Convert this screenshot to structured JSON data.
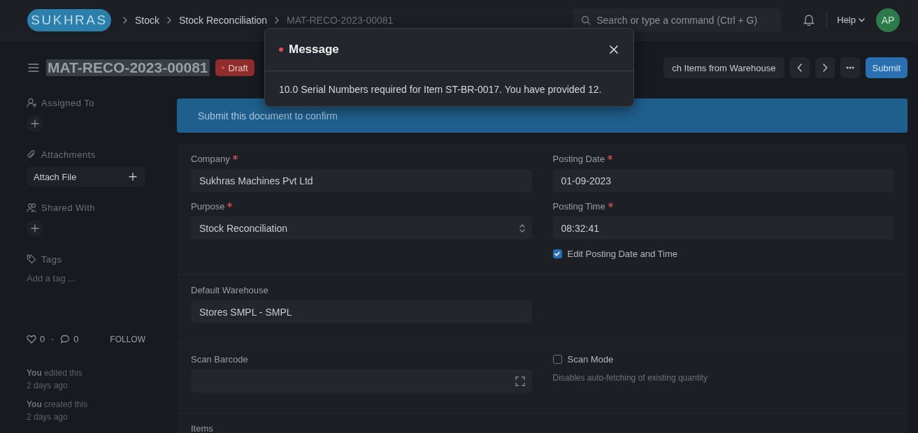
{
  "navbar": {
    "logo": "SUKHRAS",
    "breadcrumbs": [
      "Stock",
      "Stock Reconciliation",
      "MAT-RECO-2023-00081"
    ],
    "search": {
      "placeholder": "Search or type a command (Ctrl + G)"
    },
    "help": "Help",
    "avatar": "AP"
  },
  "page": {
    "title": "MAT-RECO-2023-00081",
    "status": {
      "label": "Draft",
      "color": "#e24c4c"
    },
    "actions": [
      {
        "kind": "button",
        "label": "ch Items from Warehouse"
      },
      {
        "kind": "prev"
      },
      {
        "kind": "next"
      },
      {
        "kind": "more"
      },
      {
        "kind": "primary",
        "label": "Submit"
      }
    ]
  },
  "sidebar": {
    "assigned_to": {
      "label": "Assigned To"
    },
    "attachments": {
      "label": "Attachments",
      "attach": "Attach File"
    },
    "shared_with": {
      "label": "Shared With"
    },
    "tags": {
      "label": "Tags",
      "placeholder": "Add a tag ..."
    },
    "likes": "0",
    "comments": "0",
    "follow": "FOLLOW",
    "activity": [
      {
        "text": "**You** edited this",
        "time": "2 days ago"
      },
      {
        "text": "**You** created this",
        "time": "2 days ago"
      }
    ]
  },
  "banner": "Submit this document to confirm",
  "sections": [
    {
      "columns": [
        [
          {
            "kind": "link",
            "label": "Company",
            "required": true,
            "value": "Sukhras Machines Pvt Ltd"
          },
          {
            "kind": "select",
            "label": "Purpose",
            "required": true,
            "value": "Stock Reconciliation"
          }
        ],
        [
          {
            "kind": "link",
            "label": "Posting Date",
            "required": true,
            "value": "01-09-2023"
          },
          {
            "kind": "link",
            "label": "Posting Time",
            "required": true,
            "value": "08:32:41"
          },
          {
            "kind": "checkbox",
            "label": "Edit Posting Date and Time",
            "checked": true
          }
        ]
      ]
    },
    {
      "columns": [
        [
          {
            "kind": "link",
            "label": "Default Warehouse",
            "required": false,
            "value": "Stores SMPL - SMPL"
          }
        ],
        []
      ]
    },
    {
      "columns": [
        [
          {
            "kind": "barcode",
            "label": "Scan Barcode",
            "required": false
          }
        ],
        [
          {
            "kind": "checkbox",
            "label": "Scan Mode",
            "checked": false,
            "description": "Disables auto-fetching of existing quantity"
          }
        ]
      ]
    },
    {
      "columns": [
        [
          {
            "kind": "heading",
            "label": "Items"
          }
        ],
        []
      ]
    }
  ],
  "modal": {
    "title": "Message",
    "indicator": {
      "color": "#e24c4c"
    },
    "message": "10.0 Serial Numbers required for Item ST-BR-0017. You have provided 12."
  }
}
